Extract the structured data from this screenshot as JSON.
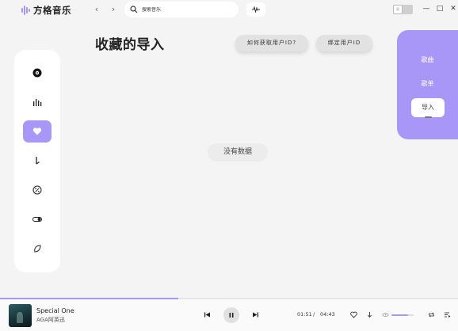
{
  "app": {
    "name": "方格音乐"
  },
  "search": {
    "placeholder": "搜索音乐"
  },
  "page": {
    "title": "收藏的导入",
    "how_to_button": "如何获取用户ID?",
    "bind_button": "绑定用户ID",
    "empty_text": "没有数据"
  },
  "sidebar": {
    "items": [
      {
        "icon": "disc-icon"
      },
      {
        "icon": "bars-chart-icon"
      },
      {
        "icon": "heart-icon",
        "active": true
      },
      {
        "icon": "music-note-icon"
      },
      {
        "icon": "percent-badge-icon"
      },
      {
        "icon": "toggle-icon"
      },
      {
        "icon": "leaf-icon"
      }
    ]
  },
  "right_panel": {
    "items": [
      "歌曲",
      "歌单",
      "导入"
    ],
    "active": "导入"
  },
  "player": {
    "song_title": "Special One",
    "artist": "AGA阿英迅",
    "current_time": "01:51",
    "separator": "/",
    "total_time": "04:43",
    "progress": 0.39,
    "volume": 0.75
  },
  "colors": {
    "accent": "#a897f7",
    "background": "#f4f4f4"
  }
}
